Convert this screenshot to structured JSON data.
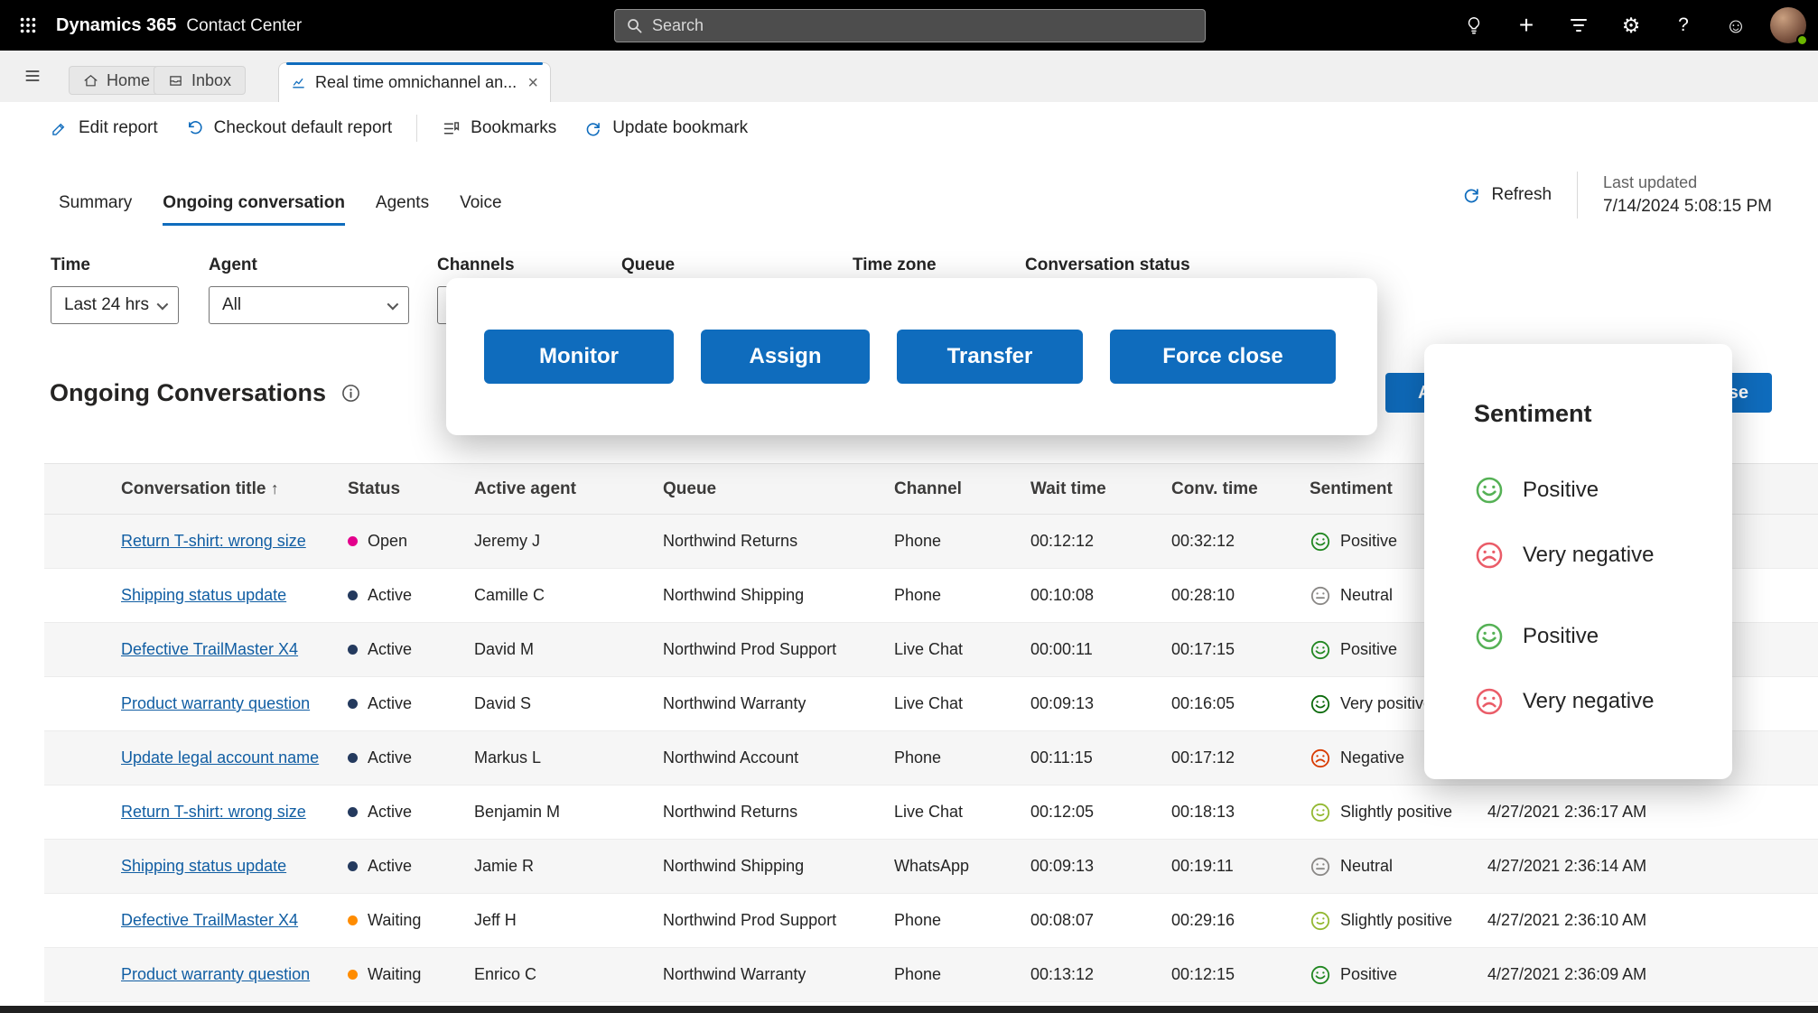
{
  "colors": {
    "accent": "#0f6cbd",
    "link": "#115ea3",
    "topbar_bg": "#000000"
  },
  "topbar": {
    "app_name": "Dynamics 365",
    "app_area": "Contact Center",
    "search_placeholder": "Search"
  },
  "tabstrip": {
    "home_label": "Home",
    "inbox_label": "Inbox",
    "active_tab_label": "Real time omnichannel an..."
  },
  "toolbar": {
    "edit_report": "Edit report",
    "checkout_default_report": "Checkout default report",
    "bookmarks": "Bookmarks",
    "update_bookmark": "Update bookmark"
  },
  "report_tabs": [
    "Summary",
    "Ongoing conversation",
    "Agents",
    "Voice"
  ],
  "refresh": {
    "label": "Refresh",
    "last_updated_label": "Last updated",
    "last_updated_value": "7/14/2024 5:08:15 PM"
  },
  "filters": [
    {
      "label": "Time",
      "value": "Last 24 hrs"
    },
    {
      "label": "Agent",
      "value": "All"
    },
    {
      "label": "Channels",
      "value": ""
    },
    {
      "label": "Queue",
      "value": ""
    },
    {
      "label": "Time zone",
      "value": ""
    },
    {
      "label": "Conversation status",
      "value": ""
    }
  ],
  "section": {
    "title": "Ongoing Conversations"
  },
  "action_callout": {
    "buttons": [
      "Monitor",
      "Assign",
      "Transfer",
      "Force close"
    ]
  },
  "underlying_actions": {
    "left_label": "Assign",
    "right_label": "Force close"
  },
  "sentiment_callout": {
    "title": "Sentiment",
    "items": [
      {
        "label": "Positive",
        "mood": "smile",
        "color": "#55b155",
        "gap": false
      },
      {
        "label": "Very negative",
        "mood": "frown",
        "color": "#ea5c68",
        "gap": false
      },
      {
        "label": "Positive",
        "mood": "smile",
        "color": "#55b155",
        "gap": true
      },
      {
        "label": "Very negative",
        "mood": "frown",
        "color": "#ea5c68",
        "gap": false
      }
    ]
  },
  "status_colors": {
    "Open": "#e3008c",
    "Active": "#243a5e",
    "Waiting": "#ff8c00"
  },
  "sentiment_styles": {
    "Very positive": {
      "mood": "smile",
      "color": "#0b6a0b"
    },
    "Positive": {
      "mood": "smile",
      "color": "#218721"
    },
    "Slightly positive": {
      "mood": "slight",
      "color": "#93b832"
    },
    "Neutral": {
      "mood": "neutral",
      "color": "#8a8886"
    },
    "Negative": {
      "mood": "frown",
      "color": "#d83b01"
    },
    "Very negative": {
      "mood": "frown",
      "color": "#d13438"
    }
  },
  "table": {
    "columns": [
      "Conversation title",
      "Status",
      "Active agent",
      "Queue",
      "Channel",
      "Wait time",
      "Conv. time",
      "Sentiment",
      ""
    ],
    "rows": [
      {
        "title": "Return T-shirt: wrong size",
        "status": "Open",
        "agent": "Jeremy J",
        "queue": "Northwind Returns",
        "channel": "Phone",
        "wait": "00:12:12",
        "conv": "00:32:12",
        "sentiment": "Positive",
        "start": ""
      },
      {
        "title": "Shipping status update",
        "status": "Active",
        "agent": "Camille C",
        "queue": "Northwind Shipping",
        "channel": "Phone",
        "wait": "00:10:08",
        "conv": "00:28:10",
        "sentiment": "Neutral",
        "start": ""
      },
      {
        "title": "Defective TrailMaster X4",
        "status": "Active",
        "agent": "David M",
        "queue": "Northwind Prod Support",
        "channel": "Live Chat",
        "wait": "00:00:11",
        "conv": "00:17:15",
        "sentiment": "Positive",
        "start": ""
      },
      {
        "title": "Product warranty question",
        "status": "Active",
        "agent": "David S",
        "queue": "Northwind Warranty",
        "channel": "Live Chat",
        "wait": "00:09:13",
        "conv": "00:16:05",
        "sentiment": "Very positive",
        "start": ""
      },
      {
        "title": "Update legal account name",
        "status": "Active",
        "agent": "Markus L",
        "queue": "Northwind Account",
        "channel": "Phone",
        "wait": "00:11:15",
        "conv": "00:17:12",
        "sentiment": "Negative",
        "start": ""
      },
      {
        "title": "Return T-shirt: wrong size",
        "status": "Active",
        "agent": "Benjamin M",
        "queue": "Northwind Returns",
        "channel": "Live Chat",
        "wait": "00:12:05",
        "conv": "00:18:13",
        "sentiment": "Slightly positive",
        "start": "4/27/2021 2:36:17 AM"
      },
      {
        "title": "Shipping status update",
        "status": "Active",
        "agent": "Jamie R",
        "queue": "Northwind Shipping",
        "channel": "WhatsApp",
        "wait": "00:09:13",
        "conv": "00:19:11",
        "sentiment": "Neutral",
        "start": "4/27/2021 2:36:14 AM"
      },
      {
        "title": "Defective TrailMaster X4",
        "status": "Waiting",
        "agent": "Jeff H",
        "queue": "Northwind Prod Support",
        "channel": "Phone",
        "wait": "00:08:07",
        "conv": "00:29:16",
        "sentiment": "Slightly positive",
        "start": "4/27/2021 2:36:10 AM"
      },
      {
        "title": "Product warranty question",
        "status": "Waiting",
        "agent": "Enrico C",
        "queue": "Northwind Warranty",
        "channel": "Phone",
        "wait": "00:13:12",
        "conv": "00:12:15",
        "sentiment": "Positive",
        "start": "4/27/2021 2:36:09 AM"
      }
    ]
  }
}
